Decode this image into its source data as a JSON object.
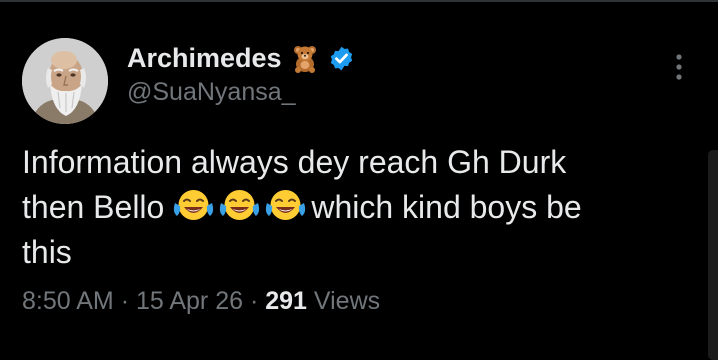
{
  "author": {
    "display_name": "Archimedes",
    "name_emoji": "teddy-bear-icon",
    "verified_icon": "verified-badge-icon",
    "handle": "@SuaNyansa_",
    "avatar": "avatar-bearded-philosopher-portrait"
  },
  "tweet": {
    "line1": "Information always dey reach Gh Durk",
    "line2_before": "then Bello",
    "line2_emojis": [
      "face-with-tears-of-joy-icon",
      "face-with-tears-of-joy-icon",
      "face-with-tears-of-joy-icon"
    ],
    "line2_after": "which kind boys be",
    "line3": "this"
  },
  "meta": {
    "time": "8:50 AM",
    "sep1": "·",
    "date": "15 Apr 26",
    "sep2": "·",
    "views_count": "291",
    "views_label": "Views"
  },
  "menu": {
    "more_icon": "more-options-icon"
  },
  "colors": {
    "background": "#000000",
    "primary_text": "#e7e9ea",
    "secondary_text": "#71767b",
    "verified_blue": "#1d9bf0",
    "divider": "#2f3336"
  }
}
